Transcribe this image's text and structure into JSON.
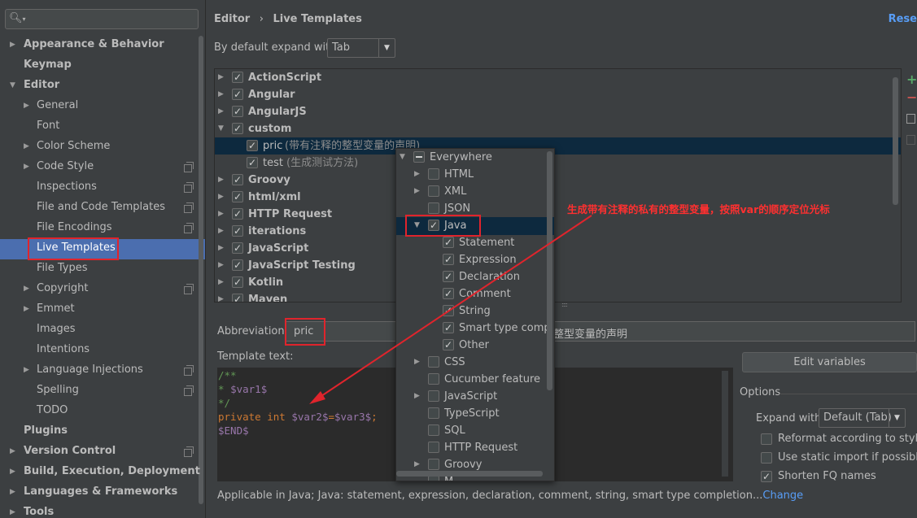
{
  "search": {
    "icon": "search-icon ▾",
    "placeholder": ""
  },
  "sidebar": {
    "items": [
      {
        "label": "Appearance & Behavior",
        "level": 0,
        "expandable": true,
        "expanded": false
      },
      {
        "label": "Keymap",
        "level": 0,
        "expandable": false
      },
      {
        "label": "Editor",
        "level": 0,
        "expandable": true,
        "expanded": true
      },
      {
        "label": "General",
        "level": 1,
        "expandable": true
      },
      {
        "label": "Font",
        "level": 1
      },
      {
        "label": "Color Scheme",
        "level": 1,
        "expandable": true
      },
      {
        "label": "Code Style",
        "level": 1,
        "expandable": true,
        "project_icon": true
      },
      {
        "label": "Inspections",
        "level": 1,
        "project_icon": true
      },
      {
        "label": "File and Code Templates",
        "level": 1,
        "project_icon": true
      },
      {
        "label": "File Encodings",
        "level": 1,
        "project_icon": true
      },
      {
        "label": "Live Templates",
        "level": 1,
        "selected": true
      },
      {
        "label": "File Types",
        "level": 1
      },
      {
        "label": "Copyright",
        "level": 1,
        "expandable": true,
        "project_icon": true
      },
      {
        "label": "Emmet",
        "level": 1,
        "expandable": true
      },
      {
        "label": "Images",
        "level": 1
      },
      {
        "label": "Intentions",
        "level": 1
      },
      {
        "label": "Language Injections",
        "level": 1,
        "expandable": true,
        "project_icon": true
      },
      {
        "label": "Spelling",
        "level": 1,
        "project_icon": true
      },
      {
        "label": "TODO",
        "level": 1
      },
      {
        "label": "Plugins",
        "level": 0
      },
      {
        "label": "Version Control",
        "level": 0,
        "expandable": true,
        "project_icon": true
      },
      {
        "label": "Build, Execution, Deployment",
        "level": 0,
        "expandable": true
      },
      {
        "label": "Languages & Frameworks",
        "level": 0,
        "expandable": true
      },
      {
        "label": "Tools",
        "level": 0,
        "expandable": true
      }
    ]
  },
  "header": {
    "breadcrumb_root": "Editor",
    "breadcrumb_sep": "›",
    "breadcrumb_leaf": "Live Templates",
    "reset": "Rese"
  },
  "expand": {
    "label": "By default expand with",
    "value": "Tab"
  },
  "template_groups": [
    {
      "label": "ActionScript",
      "checked": true,
      "expanded": false
    },
    {
      "label": "Angular",
      "checked": true,
      "expanded": false
    },
    {
      "label": "AngularJS",
      "checked": true,
      "expanded": false
    },
    {
      "label": "custom",
      "checked": true,
      "expanded": true
    },
    {
      "label": "pric",
      "desc": "(带有注释的整型变量的声明)",
      "checked": true,
      "child": true,
      "selected": true
    },
    {
      "label": "test",
      "desc": "(生成测试方法)",
      "checked": true,
      "child": true
    },
    {
      "label": "Groovy",
      "checked": true,
      "expanded": false
    },
    {
      "label": "html/xml",
      "checked": true,
      "expanded": false
    },
    {
      "label": "HTTP Request",
      "checked": true,
      "expanded": false
    },
    {
      "label": "iterations",
      "checked": true,
      "expanded": false
    },
    {
      "label": "JavaScript",
      "checked": true,
      "expanded": false
    },
    {
      "label": "JavaScript Testing",
      "checked": true,
      "expanded": false
    },
    {
      "label": "Kotlin",
      "checked": true,
      "expanded": false
    },
    {
      "label": "Maven",
      "checked": true,
      "expanded": false
    }
  ],
  "abbreviation": {
    "label": "Abbreviation:",
    "value": "pric",
    "description": "整型变量的声明"
  },
  "template_text": {
    "label": "Template text:",
    "lines": [
      "/**",
      " * $var1$",
      " */",
      "private int $var2$=$var3$;",
      "$END$"
    ]
  },
  "edit_variables": "Edit variables",
  "options": {
    "title": "Options",
    "expand_with_label": "Expand with",
    "expand_with_value": "Default (Tab)",
    "reformat": {
      "label": "Reformat according to style",
      "checked": false
    },
    "static_import": {
      "label": "Use static import if possible",
      "checked": false
    },
    "shorten_fq": {
      "label": "Shorten FQ names",
      "checked": true
    }
  },
  "applicable": {
    "text": "Applicable in Java; Java: statement, expression, declaration, comment, string, smart type completion...",
    "link": "Change"
  },
  "context_popup": {
    "items": [
      {
        "label": "Everywhere",
        "state": "partial",
        "level": 0,
        "arrow": "down"
      },
      {
        "label": "HTML",
        "state": "unchecked",
        "level": 1,
        "arrow": "right"
      },
      {
        "label": "XML",
        "state": "unchecked",
        "level": 1,
        "arrow": "right"
      },
      {
        "label": "JSON",
        "state": "unchecked",
        "level": 1
      },
      {
        "label": "Java",
        "state": "checked",
        "level": 1,
        "arrow": "down",
        "selected": true
      },
      {
        "label": "Statement",
        "state": "checked",
        "level": 2
      },
      {
        "label": "Expression",
        "state": "checked",
        "level": 2
      },
      {
        "label": "Declaration",
        "state": "checked",
        "level": 2
      },
      {
        "label": "Comment",
        "state": "checked",
        "level": 2
      },
      {
        "label": "String",
        "state": "checked",
        "level": 2
      },
      {
        "label": "Smart type completion",
        "state": "checked",
        "level": 2
      },
      {
        "label": "Other",
        "state": "checked",
        "level": 2
      },
      {
        "label": "CSS",
        "state": "unchecked",
        "level": 1,
        "arrow": "right"
      },
      {
        "label": "Cucumber feature",
        "state": "unchecked",
        "level": 1
      },
      {
        "label": "JavaScript",
        "state": "unchecked",
        "level": 1,
        "arrow": "right"
      },
      {
        "label": "TypeScript",
        "state": "unchecked",
        "level": 1
      },
      {
        "label": "SQL",
        "state": "unchecked",
        "level": 1
      },
      {
        "label": "HTTP Request",
        "state": "unchecked",
        "level": 1
      },
      {
        "label": "Groovy",
        "state": "unchecked",
        "level": 1,
        "arrow": "right"
      },
      {
        "label": "M...",
        "state": "unchecked",
        "level": 1
      }
    ]
  },
  "annotation": "生成带有注释的私有的整型变量，按照var的顺序定位光标",
  "colors": {
    "accent": "#4b6eaf",
    "highlight": "#e0242c",
    "link": "#589df6"
  }
}
